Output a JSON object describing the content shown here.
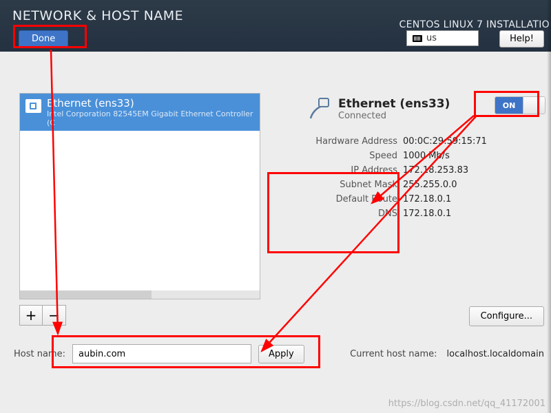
{
  "header": {
    "page_title": "NETWORK & HOST NAME",
    "install_title": "CENTOS LINUX 7 INSTALLATIO",
    "done": "Done",
    "keyboard_layout": "us",
    "help": "Help!"
  },
  "nic_list": {
    "items": [
      {
        "name": "Ethernet (ens33)",
        "subtitle": "Intel Corporation 82545EM Gigabit Ethernet Controller (C"
      }
    ],
    "add": "+",
    "remove": "−"
  },
  "detail": {
    "name": "Ethernet (ens33)",
    "status": "Connected",
    "fields": [
      {
        "label": "Hardware Address",
        "value": "00:0C:29:59:15:71"
      },
      {
        "label": "Speed",
        "value": "1000 Mb/s"
      },
      {
        "label": "IP Address",
        "value": "172.18.253.83"
      },
      {
        "label": "Subnet Mask",
        "value": "255.255.0.0"
      },
      {
        "label": "Default Route",
        "value": "172.18.0.1"
      },
      {
        "label": "DNS",
        "value": "172.18.0.1"
      }
    ],
    "toggle": "ON",
    "configure": "Configure..."
  },
  "host": {
    "label": "Host name:",
    "value": "aubin.com",
    "apply": "Apply",
    "current_label": "Current host name:",
    "current_value": "localhost.localdomain"
  },
  "watermark": "https://blog.csdn.net/qq_41172001"
}
